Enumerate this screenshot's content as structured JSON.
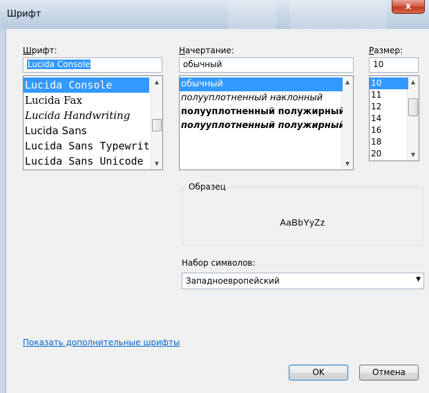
{
  "window": {
    "title": "Шрифт",
    "close_glyph": "x"
  },
  "font": {
    "label": "Шрифт:",
    "access_key": "Ш",
    "value": "Lucida Console",
    "items": [
      "Lucida Console",
      "Lucida Fax",
      "Lucida Handwriting",
      "Lucida Sans",
      "Lucida Sans Typewriter",
      "Lucida Sans Unicode"
    ],
    "selected_index": 0
  },
  "style": {
    "label": "Начертание:",
    "access_key": "Н",
    "value": "обычный",
    "items": [
      "обычный",
      "полууплотненный наклонный",
      "полууплотненный полужирный",
      "полууплотненный полужирный наклонный"
    ],
    "selected_index": 0
  },
  "size": {
    "label": "Размер:",
    "access_key": "Р",
    "value": "10",
    "items": [
      "10",
      "11",
      "12",
      "14",
      "16",
      "18",
      "20"
    ],
    "selected_index": 0
  },
  "sample": {
    "legend": "Образец",
    "text": "AaBbYyZz"
  },
  "charset": {
    "label": "Набор символов:",
    "value": "Западноевропейский"
  },
  "more_fonts_link": "Показать дополнительные шрифты",
  "buttons": {
    "ok": "OK",
    "cancel": "Отмена"
  },
  "colors": {
    "selection": "#3399ff",
    "link": "#0066cc",
    "close_button": "#c9452b"
  }
}
